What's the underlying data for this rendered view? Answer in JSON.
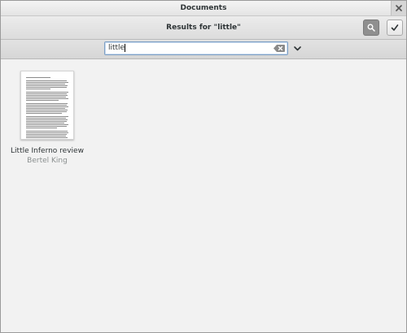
{
  "window": {
    "title": "Documents"
  },
  "header": {
    "title": "Results for \"little\""
  },
  "icons": {
    "close": "close-icon",
    "search": "search-icon",
    "select": "checkmark-icon",
    "clear": "edit-clear-icon",
    "dropdown": "chevron-down-icon"
  },
  "search": {
    "value": "little"
  },
  "documents": [
    {
      "title": "Little Inferno review",
      "author": "Bertel King"
    }
  ]
}
